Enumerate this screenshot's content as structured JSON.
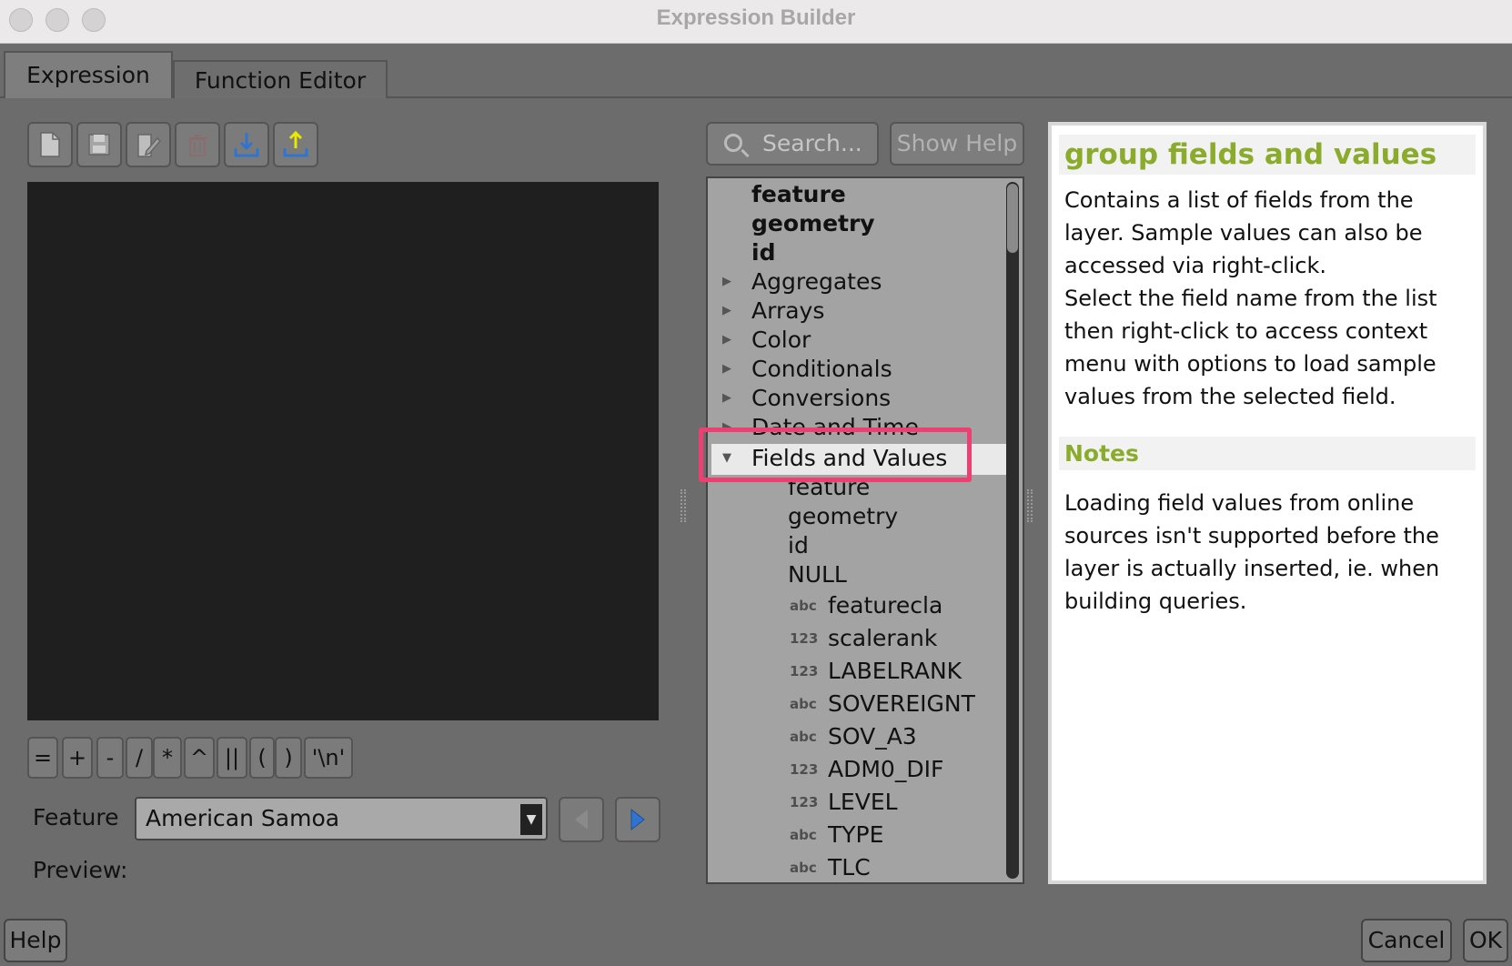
{
  "window": {
    "title": "Expression Builder"
  },
  "tabs": [
    {
      "label": "Expression",
      "active": true
    },
    {
      "label": "Function Editor",
      "active": false
    }
  ],
  "toolbar": {
    "icons": [
      "new-file-icon",
      "save-icon",
      "edit-icon",
      "delete-icon",
      "import-icon",
      "export-icon"
    ]
  },
  "operators": [
    "=",
    "+",
    "-",
    "/",
    "*",
    "^",
    "||",
    "(",
    ")",
    "'\\n'"
  ],
  "feature": {
    "label": "Feature",
    "selected": "American Samoa"
  },
  "preview": {
    "label": "Preview:"
  },
  "search": {
    "placeholder": "Search..."
  },
  "show_help": {
    "label": "Show Help"
  },
  "tree": {
    "top_items": [
      "feature",
      "geometry",
      "id"
    ],
    "groups": [
      "Aggregates",
      "Arrays",
      "Color",
      "Conditionals",
      "Conversions",
      "Date and Time"
    ],
    "expanded_group": "Fields and Values",
    "children": [
      "feature",
      "geometry",
      "id",
      "NULL"
    ],
    "fields": [
      {
        "type": "abc",
        "name": "featurecla"
      },
      {
        "type": "123",
        "name": "scalerank"
      },
      {
        "type": "123",
        "name": "LABELRANK"
      },
      {
        "type": "abc",
        "name": "SOVEREIGNT"
      },
      {
        "type": "abc",
        "name": "SOV_A3"
      },
      {
        "type": "123",
        "name": "ADM0_DIF"
      },
      {
        "type": "123",
        "name": "LEVEL"
      },
      {
        "type": "abc",
        "name": "TYPE"
      },
      {
        "type": "abc",
        "name": "TLC"
      }
    ]
  },
  "help": {
    "title": "group fields and values",
    "p1": "Contains a list of fields from the layer. Sample values can also be accessed via right-click.",
    "p2": "Select the field name from the list then right-click to access context menu with options to load sample values from the selected field.",
    "notes_title": "Notes",
    "notes_text": "Loading field values from online sources isn't supported before the layer is actually inserted, ie. when building queries."
  },
  "buttons": {
    "help": "Help",
    "cancel": "Cancel",
    "ok": "OK"
  },
  "colors": {
    "accent_green": "#8bab2c",
    "highlight_pink": "#ee3f72"
  }
}
